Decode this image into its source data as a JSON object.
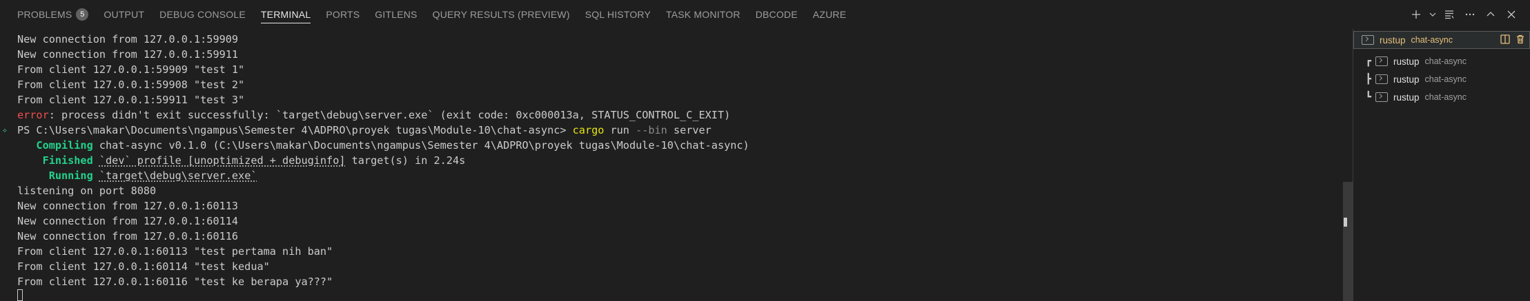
{
  "tabs": [
    {
      "label": "PROBLEMS",
      "badge": "5",
      "active": false
    },
    {
      "label": "OUTPUT",
      "active": false
    },
    {
      "label": "DEBUG CONSOLE",
      "active": false
    },
    {
      "label": "TERMINAL",
      "active": true
    },
    {
      "label": "PORTS",
      "active": false
    },
    {
      "label": "GITLENS",
      "active": false
    },
    {
      "label": "QUERY RESULTS (PREVIEW)",
      "active": false
    },
    {
      "label": "SQL HISTORY",
      "active": false
    },
    {
      "label": "TASK MONITOR",
      "active": false
    },
    {
      "label": "DBCODE",
      "active": false
    },
    {
      "label": "AZURE",
      "active": false
    }
  ],
  "actions": {
    "new_terminal": "plus-icon",
    "launch_profile": "chevron-down-icon",
    "clear": "list-icon",
    "more": "ellipsis-icon",
    "maximize": "chevron-up-icon",
    "close": "close-icon"
  },
  "terminal": {
    "lines": {
      "l1": "New connection from 127.0.0.1:59909",
      "l2": "New connection from 127.0.0.1:59911",
      "l3": "From client 127.0.0.1:59909 \"test 1\"",
      "l4": "From client 127.0.0.1:59908 \"test 2\"",
      "l5": "From client 127.0.0.1:59911 \"test 3\"",
      "l6_prefix": "error",
      "l6_rest": ": process didn't exit successfully: `target\\debug\\server.exe` (exit code: 0xc000013a, STATUS_CONTROL_C_EXIT)",
      "l7_prompt": "PS C:\\Users\\makar\\Documents\\ngampus\\Semester 4\\ADPRO\\proyek tugas\\Module-10\\chat-async> ",
      "l7_cmd": "cargo",
      "l7_mid": " run ",
      "l7_flag": "--bin",
      "l7_arg": " server",
      "l8_label": "   Compiling",
      "l8_rest": " chat-async v0.1.0 (C:\\Users\\makar\\Documents\\ngampus\\Semester 4\\ADPRO\\proyek tugas\\Module-10\\chat-async)",
      "l9_label": "    Finished",
      "l9_sp": " ",
      "l9_profile": "`dev` profile [unoptimized + debuginfo]",
      "l9_rest": " target(s) in 2.24s",
      "l10_label": "     Running",
      "l10_sp": " ",
      "l10_rest": "`target\\debug\\server.exe`",
      "l11": "listening on port 8080",
      "l12": "New connection from 127.0.0.1:60113",
      "l13": "New connection from 127.0.0.1:60114",
      "l14": "New connection from 127.0.0.1:60116",
      "l15": "From client 127.0.0.1:60113 \"test pertama nih ban\"",
      "l16": "From client 127.0.0.1:60114 \"test kedua\"",
      "l17": "From client 127.0.0.1:60116 \"test ke berapa ya???\""
    }
  },
  "sidebar": {
    "group": {
      "name": "rustup",
      "desc": "chat-async"
    },
    "items": [
      {
        "name": "rustup",
        "desc": "chat-async"
      },
      {
        "name": "rustup",
        "desc": "chat-async"
      },
      {
        "name": "rustup",
        "desc": "chat-async"
      }
    ]
  },
  "colors": {
    "accent": "#e5c07b",
    "error": "#f14c4c",
    "success": "#23d18b",
    "command": "#e5e510"
  }
}
